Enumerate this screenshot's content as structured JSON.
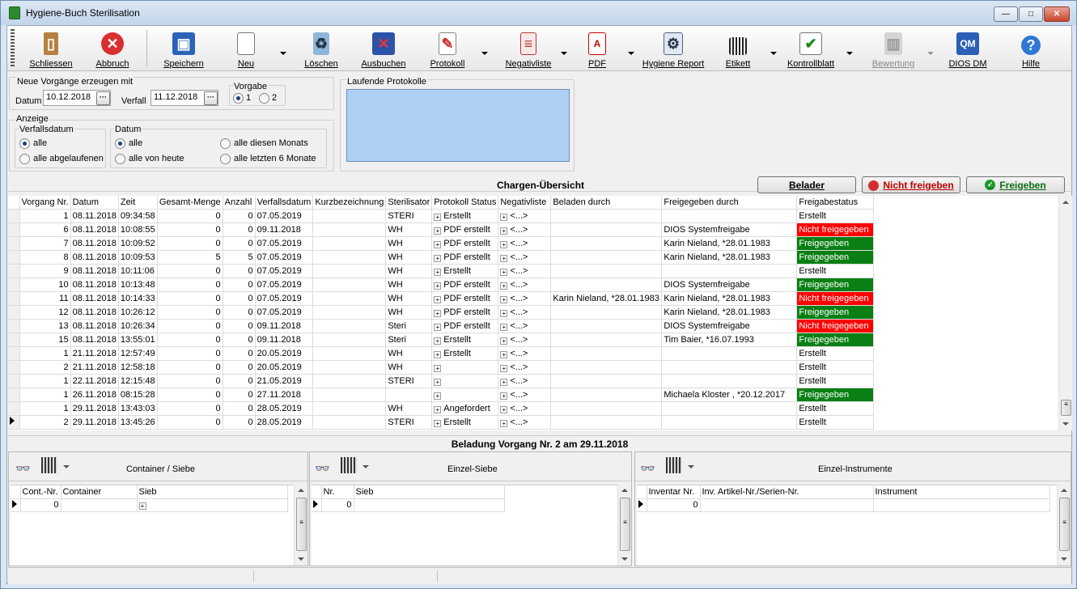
{
  "window": {
    "title": "Hygiene-Buch Sterilisation"
  },
  "toolbar": {
    "close_label": "Schliessen",
    "cancel_label": "Abbruch",
    "save_label": "Speichern",
    "new_label": "Neu",
    "delete_label": "Löschen",
    "checkout_label": "Ausbuchen",
    "protocol_label": "Protokoll",
    "negativelist_label": "Negativliste",
    "pdf_label": "PDF",
    "hygiene_report_label": "Hygiene Report",
    "label_label": "Etikett",
    "checklist_label": "Kontrollblatt",
    "rating_label": "Bewertung",
    "dios_label": "DIOS DM",
    "help_label": "Hilfe"
  },
  "create": {
    "group_label": "Neue Vorgänge erzeugen mit",
    "date_label": "Datum",
    "date_value": "10.12.2018",
    "expiry_label": "Verfall",
    "expiry_value": "11.12.2018",
    "template_label": "Vorgabe",
    "template_opt1": "1",
    "template_opt2": "2"
  },
  "display": {
    "group_label": "Anzeige",
    "expiry_group_label": "Verfallsdatum",
    "expiry_all": "alle",
    "expiry_expired": "alle abgelaufenen",
    "date_group_label": "Datum",
    "date_all": "alle",
    "date_today": "alle von heute",
    "date_month": "alle diesen Monats",
    "date_6months": "alle letzten 6 Monate"
  },
  "running": {
    "label": "Laufende Protokolle"
  },
  "overview": {
    "title": "Chargen-Übersicht",
    "loader_button": "Belader",
    "reject_button": "Nicht freigeben",
    "approve_button": "Freigeben"
  },
  "colors": {
    "red": "#ff0000",
    "green": "#0a7f14",
    "running_bg": "#aed0f5"
  },
  "table": {
    "columns": [
      "Vorgang Nr.",
      "Datum",
      "Zeit",
      "Gesamt-Menge",
      "Anzahl",
      "Verfallsdatum",
      "Kurzbezeichnung",
      "Sterilisator",
      "Protokoll Status",
      "Negativliste",
      "Beladen durch",
      "Freigegeben durch",
      "Freigabestatus"
    ],
    "rows": [
      {
        "nr": "1",
        "datum": "08.11.2018",
        "zeit": "09:34:58",
        "menge": "0",
        "anzahl": "0",
        "verfall": "07.05.2019",
        "kurz": "",
        "steri": "STERI",
        "proto": "Erstellt",
        "neg": "<...>",
        "beladen": "",
        "frei": "",
        "status": "Erstellt",
        "color": "none"
      },
      {
        "nr": "6",
        "datum": "08.11.2018",
        "zeit": "10:08:55",
        "menge": "0",
        "anzahl": "0",
        "verfall": "09.11.2018",
        "kurz": "",
        "steri": "WH",
        "proto": "PDF erstellt",
        "neg": "<...>",
        "beladen": "",
        "frei": "DIOS Systemfreigabe",
        "status": "Nicht freigegeben",
        "color": "red"
      },
      {
        "nr": "7",
        "datum": "08.11.2018",
        "zeit": "10:09:52",
        "menge": "0",
        "anzahl": "0",
        "verfall": "07.05.2019",
        "kurz": "",
        "steri": "WH",
        "proto": "PDF erstellt",
        "neg": "<...>",
        "beladen": "",
        "frei": "Karin Nieland, *28.01.1983",
        "status": "Freigegeben",
        "color": "green"
      },
      {
        "nr": "8",
        "datum": "08.11.2018",
        "zeit": "10:09:53",
        "menge": "5",
        "anzahl": "5",
        "verfall": "07.05.2019",
        "kurz": "",
        "steri": "WH",
        "proto": "PDF erstellt",
        "neg": "<...>",
        "beladen": "",
        "frei": "Karin Nieland, *28.01.1983",
        "status": "Freigegeben",
        "color": "green"
      },
      {
        "nr": "9",
        "datum": "08.11.2018",
        "zeit": "10:11:06",
        "menge": "0",
        "anzahl": "0",
        "verfall": "07.05.2019",
        "kurz": "",
        "steri": "WH",
        "proto": "Erstellt",
        "neg": "<...>",
        "beladen": "",
        "frei": "",
        "status": "Erstellt",
        "color": "none"
      },
      {
        "nr": "10",
        "datum": "08.11.2018",
        "zeit": "10:13:48",
        "menge": "0",
        "anzahl": "0",
        "verfall": "07.05.2019",
        "kurz": "",
        "steri": "WH",
        "proto": "PDF erstellt",
        "neg": "<...>",
        "beladen": "",
        "frei": "DIOS Systemfreigabe",
        "status": "Freigegeben",
        "color": "green"
      },
      {
        "nr": "11",
        "datum": "08.11.2018",
        "zeit": "10:14:33",
        "menge": "0",
        "anzahl": "0",
        "verfall": "07.05.2019",
        "kurz": "",
        "steri": "WH",
        "proto": "PDF erstellt",
        "neg": "<...>",
        "beladen": "Karin Nieland, *28.01.1983",
        "frei": "Karin Nieland, *28.01.1983",
        "status": "Nicht freigegeben",
        "color": "red"
      },
      {
        "nr": "12",
        "datum": "08.11.2018",
        "zeit": "10:26:12",
        "menge": "0",
        "anzahl": "0",
        "verfall": "07.05.2019",
        "kurz": "",
        "steri": "WH",
        "proto": "PDF erstellt",
        "neg": "<...>",
        "beladen": "",
        "frei": "Karin Nieland, *28.01.1983",
        "status": "Freigegeben",
        "color": "green"
      },
      {
        "nr": "13",
        "datum": "08.11.2018",
        "zeit": "10:26:34",
        "menge": "0",
        "anzahl": "0",
        "verfall": "09.11.2018",
        "kurz": "",
        "steri": "Steri",
        "proto": "PDF erstellt",
        "neg": "<...>",
        "beladen": "",
        "frei": "DIOS Systemfreigabe",
        "status": "Nicht freigegeben",
        "color": "red"
      },
      {
        "nr": "15",
        "datum": "08.11.2018",
        "zeit": "13:55:01",
        "menge": "0",
        "anzahl": "0",
        "verfall": "09.11.2018",
        "kurz": "",
        "steri": "Steri",
        "proto": "Erstellt",
        "neg": "<...>",
        "beladen": "",
        "frei": "Tim  Baier, *16.07.1993",
        "status": "Freigegeben",
        "color": "green"
      },
      {
        "nr": "1",
        "datum": "21.11.2018",
        "zeit": "12:57:49",
        "menge": "0",
        "anzahl": "0",
        "verfall": "20.05.2019",
        "kurz": "",
        "steri": "WH",
        "proto": "Erstellt",
        "neg": "<...>",
        "beladen": "",
        "frei": "",
        "status": "Erstellt",
        "color": "none"
      },
      {
        "nr": "2",
        "datum": "21.11.2018",
        "zeit": "12:58:18",
        "menge": "0",
        "anzahl": "0",
        "verfall": "20.05.2019",
        "kurz": "",
        "steri": "WH",
        "proto": "",
        "neg": "<...>",
        "beladen": "",
        "frei": "",
        "status": "Erstellt",
        "color": "none"
      },
      {
        "nr": "1",
        "datum": "22.11.2018",
        "zeit": "12:15:48",
        "menge": "0",
        "anzahl": "0",
        "verfall": "21.05.2019",
        "kurz": "",
        "steri": "STERI",
        "proto": "",
        "neg": "<...>",
        "beladen": "",
        "frei": "",
        "status": "Erstellt",
        "color": "none"
      },
      {
        "nr": "1",
        "datum": "26.11.2018",
        "zeit": "08:15:28",
        "menge": "0",
        "anzahl": "0",
        "verfall": "27.11.2018",
        "kurz": "",
        "steri": "",
        "proto": "",
        "neg": "<...>",
        "beladen": "",
        "frei": "Michaela  Kloster , *20.12.2017",
        "status": "Freigegeben",
        "color": "green"
      },
      {
        "nr": "1",
        "datum": "29.11.2018",
        "zeit": "13:43:03",
        "menge": "0",
        "anzahl": "0",
        "verfall": "28.05.2019",
        "kurz": "",
        "steri": "WH",
        "proto": "Angefordert",
        "neg": "<...>",
        "beladen": "",
        "frei": "",
        "status": "Erstellt",
        "color": "none"
      },
      {
        "nr": "2",
        "datum": "29.11.2018",
        "zeit": "13:45:26",
        "menge": "0",
        "anzahl": "0",
        "verfall": "28.05.2019",
        "kurz": "",
        "steri": "STERI",
        "proto": "Erstellt",
        "neg": "<...>",
        "beladen": "",
        "frei": "",
        "status": "Erstellt",
        "color": "none",
        "current": true
      }
    ]
  },
  "loading": {
    "title": "Beladung Vorgang Nr. 2 am 29.11.2018",
    "container": {
      "title": "Container / Siebe",
      "cols": [
        "Cont.-Nr.",
        "Container",
        "Sieb"
      ],
      "row": [
        "0",
        "",
        ""
      ]
    },
    "single": {
      "title": "Einzel-Siebe",
      "cols": [
        "Nr.",
        "Sieb"
      ],
      "row": [
        "0",
        ""
      ]
    },
    "instruments": {
      "title": "Einzel-Instrumente",
      "cols": [
        "Inventar Nr.",
        "Inv. Artikel-Nr./Serien-Nr.",
        "Instrument"
      ],
      "row": [
        "0",
        "",
        ""
      ]
    }
  }
}
